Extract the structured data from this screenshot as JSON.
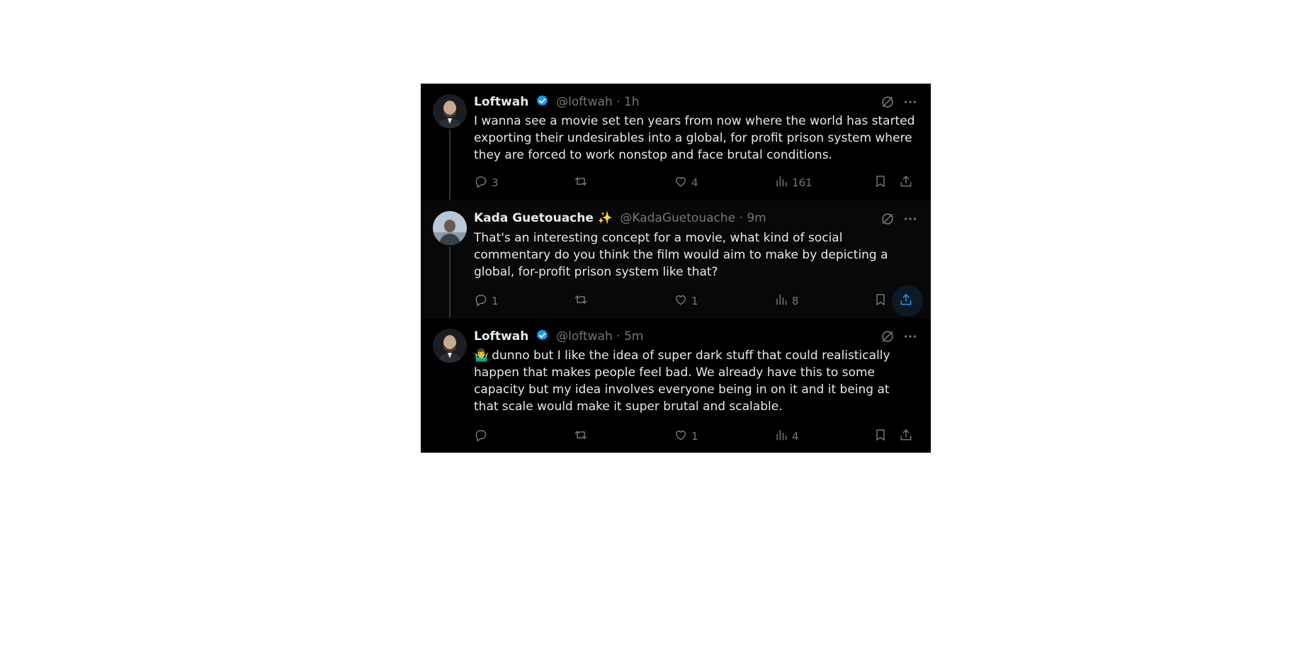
{
  "tweets": [
    {
      "name": "Loftwah",
      "verified": true,
      "handle": "@loftwah",
      "separator": "·",
      "time": "1h",
      "text": "I wanna see a movie set ten years from now where the world has started exporting their undesirables into a global, for profit prison system where they are forced to work nonstop and face brutal conditions.",
      "replies": "3",
      "retweets": "",
      "likes": "4",
      "views": "161"
    },
    {
      "name": "Kada Guetouache ✨",
      "verified": false,
      "handle": "@KadaGuetouache",
      "separator": "·",
      "time": "9m",
      "text": "That's an interesting concept for a movie, what kind of social commentary do you think the film would aim to make by depicting a global, for-profit prison system like that?",
      "replies": "1",
      "retweets": "",
      "likes": "1",
      "views": "8"
    },
    {
      "name": "Loftwah",
      "verified": true,
      "handle": "@loftwah",
      "separator": "·",
      "time": "5m",
      "emoji": "🤷‍♂️",
      "text": "dunno but I like the idea of super dark stuff that could realistically happen that makes people feel bad. We already have this to some capacity but my idea involves everyone being in on it and it being at that scale would make it super brutal and scalable.",
      "replies": "",
      "retweets": "",
      "likes": "1",
      "views": "4"
    }
  ],
  "icons": {
    "verified": "verified-badge-icon",
    "grok": "grok-icon",
    "more": "more-icon",
    "reply": "reply-icon",
    "retweet": "retweet-icon",
    "like": "heart-icon",
    "views": "views-icon",
    "bookmark": "bookmark-icon",
    "share": "share-icon"
  },
  "colors": {
    "background": "#000000",
    "text": "#e7e9ea",
    "muted": "#71767b",
    "verified": "#1d9bf0"
  }
}
